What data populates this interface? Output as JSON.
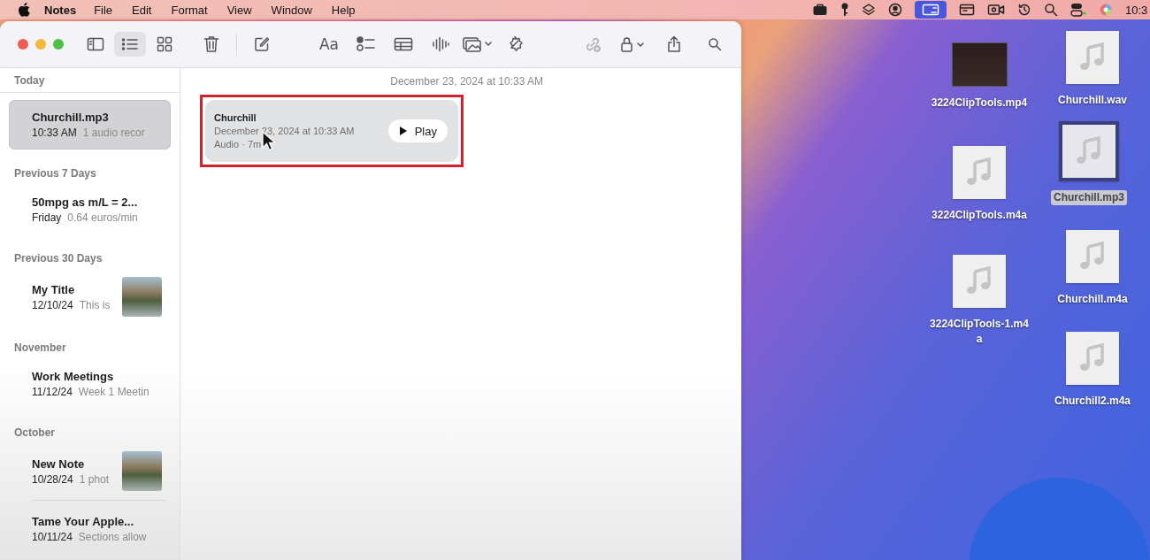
{
  "menu_bar": {
    "app_name": "Notes",
    "items": [
      "File",
      "Edit",
      "Format",
      "View",
      "Window",
      "Help"
    ],
    "clock": "10:3"
  },
  "toolbar": {
    "view_modes": [
      {
        "kind": "list",
        "selected": true
      },
      {
        "kind": "gallery",
        "selected": false
      }
    ],
    "format_label": "Aa"
  },
  "sidebar": {
    "sections": [
      {
        "title": "Today",
        "notes": [
          {
            "title": "Churchill.mp3",
            "date": "10:33 AM",
            "preview": "1 audio recor",
            "selected": true,
            "has_photo": false
          }
        ]
      },
      {
        "title": "Previous 7 Days",
        "notes": [
          {
            "title": "50mpg as m/L = 2...",
            "date": "Friday",
            "preview": "0.64 euros/min",
            "selected": false,
            "has_photo": false
          }
        ]
      },
      {
        "title": "Previous 30 Days",
        "notes": [
          {
            "title": "My Title",
            "date": "12/10/24",
            "preview": "This is",
            "selected": false,
            "has_photo": true
          }
        ]
      },
      {
        "title": "November",
        "notes": [
          {
            "title": "Work Meetings",
            "date": "11/12/24",
            "preview": "Week 1 Meetin",
            "selected": false,
            "has_photo": false
          }
        ]
      },
      {
        "title": "October",
        "notes": [
          {
            "title": "New Note",
            "date": "10/28/24",
            "preview": "1 phot",
            "selected": false,
            "has_photo": true
          },
          {
            "title": "Tame Your Apple...",
            "date": "10/11/24",
            "preview": "Sections allow",
            "selected": false,
            "has_photo": false
          }
        ]
      }
    ]
  },
  "note": {
    "date_header": "December 23, 2024 at 10:33 AM",
    "attachment": {
      "title": "Churchill",
      "date": "December 23, 2024 at 10:33 AM",
      "meta": "Audio · 7m",
      "button": "Play",
      "highlighted": true
    }
  },
  "desktop": {
    "icons": [
      {
        "name": "3224ClipTools.mp4",
        "kind": "video",
        "selected": false
      },
      {
        "name": "3224ClipTools.m4a",
        "kind": "audio",
        "selected": false
      },
      {
        "name": "3224ClipTools-1.m4a",
        "kind": "audio",
        "selected": false
      },
      {
        "name": "Churchill.wav",
        "kind": "audio",
        "selected": false
      },
      {
        "name": "Churchill.mp3",
        "kind": "audio",
        "selected": true
      },
      {
        "name": "Churchill.m4a",
        "kind": "audio",
        "selected": false
      },
      {
        "name": "Churchill2.m4a",
        "kind": "audio",
        "selected": false
      }
    ]
  }
}
